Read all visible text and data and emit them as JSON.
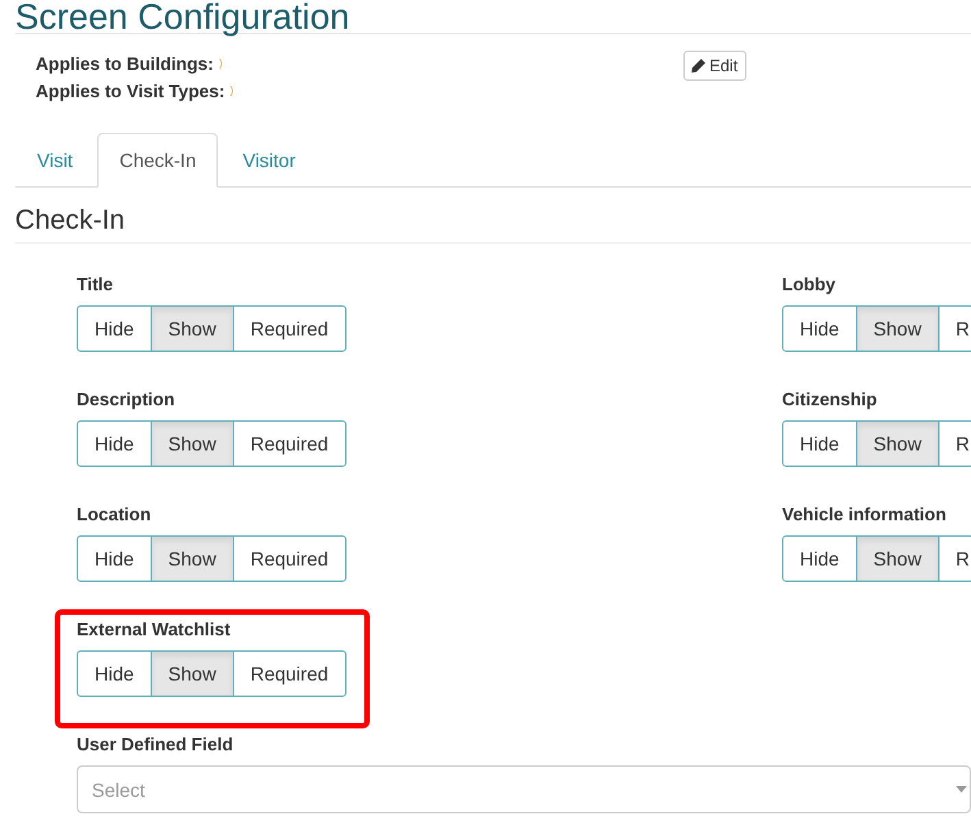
{
  "header": {
    "title": "Screen Configuration",
    "applies": [
      {
        "label": "Applies to Buildings:"
      },
      {
        "label": "Applies to Visit Types:"
      }
    ],
    "edit_button": "Edit"
  },
  "tabs": [
    {
      "label": "Visit",
      "selected": false
    },
    {
      "label": "Check-In",
      "selected": true
    },
    {
      "label": "Visitor",
      "selected": false
    }
  ],
  "section": {
    "title": "Check-In",
    "left_fields": [
      {
        "label": "Title",
        "highlighted": false,
        "options": [
          {
            "label": "Hide",
            "selected": false
          },
          {
            "label": "Show",
            "selected": true
          },
          {
            "label": "Required",
            "selected": false
          }
        ]
      },
      {
        "label": "Description",
        "highlighted": false,
        "options": [
          {
            "label": "Hide",
            "selected": false
          },
          {
            "label": "Show",
            "selected": true
          },
          {
            "label": "Required",
            "selected": false
          }
        ]
      },
      {
        "label": "Location",
        "highlighted": false,
        "options": [
          {
            "label": "Hide",
            "selected": false
          },
          {
            "label": "Show",
            "selected": true
          },
          {
            "label": "Required",
            "selected": false
          }
        ]
      },
      {
        "label": "External Watchlist",
        "highlighted": true,
        "options": [
          {
            "label": "Hide",
            "selected": false
          },
          {
            "label": "Show",
            "selected": true
          },
          {
            "label": "Required",
            "selected": false
          }
        ]
      }
    ],
    "right_fields": [
      {
        "label": "Lobby",
        "highlighted": false,
        "options": [
          {
            "label": "Hide",
            "selected": false
          },
          {
            "label": "Show",
            "selected": true
          },
          {
            "label": "R",
            "selected": false
          }
        ]
      },
      {
        "label": "Citizenship",
        "highlighted": false,
        "options": [
          {
            "label": "Hide",
            "selected": false
          },
          {
            "label": "Show",
            "selected": true
          },
          {
            "label": "R",
            "selected": false
          }
        ]
      },
      {
        "label": "Vehicle information",
        "highlighted": false,
        "options": [
          {
            "label": "Hide",
            "selected": false
          },
          {
            "label": "Show",
            "selected": true
          },
          {
            "label": "R",
            "selected": false
          }
        ]
      }
    ],
    "user_defined_field": {
      "label": "User Defined Field",
      "placeholder": "Select"
    }
  }
}
